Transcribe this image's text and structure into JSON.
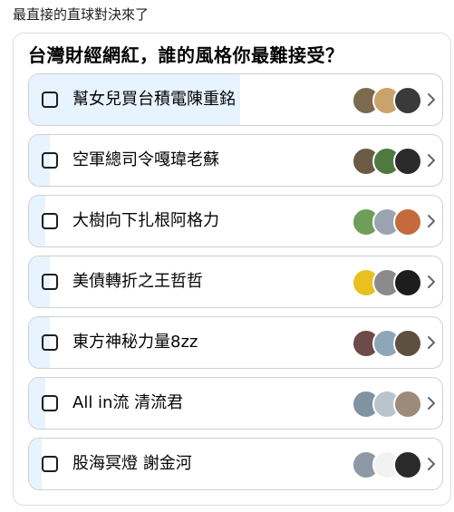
{
  "post": {
    "text": "最直接的直球對決來了"
  },
  "poll": {
    "question": "台灣財經網紅，誰的風格你最難接受？",
    "options": [
      {
        "label": "幫女兒買台積電陳重銘",
        "fill": 0.51,
        "avatars": [
          "#7b6a4e",
          "#c9a36b",
          "#3a3a3a"
        ]
      },
      {
        "label": "空軍總司令嘎瑋老蘇",
        "fill": 0.05,
        "avatars": [
          "#6b5a44",
          "#4f7a3f",
          "#2b2b2b"
        ]
      },
      {
        "label": "大樹向下扎根阿格力",
        "fill": 0.04,
        "avatars": [
          "#6f9e58",
          "#9aa4b0",
          "#c46a3c"
        ]
      },
      {
        "label": "美債轉折之王哲哲",
        "fill": 0.05,
        "avatars": [
          "#e8c020",
          "#8a8a8a",
          "#1d1d1d"
        ]
      },
      {
        "label": "東方神秘力量8zz",
        "fill": 0.05,
        "avatars": [
          "#6e4a4a",
          "#8fa6b8",
          "#5d5040"
        ]
      },
      {
        "label": "All in流 清流君",
        "fill": 0.04,
        "avatars": [
          "#7f93a3",
          "#b9c5cc",
          "#9c8a7a"
        ]
      },
      {
        "label": "股海冥燈 謝金河",
        "fill": 0.03,
        "avatars": [
          "#8d99a6",
          "#f2f2f2",
          "#2a2a2a"
        ]
      }
    ]
  },
  "colors": {
    "fill": "#e7f3ff",
    "border": "#ced0d4",
    "text": "#050505"
  }
}
